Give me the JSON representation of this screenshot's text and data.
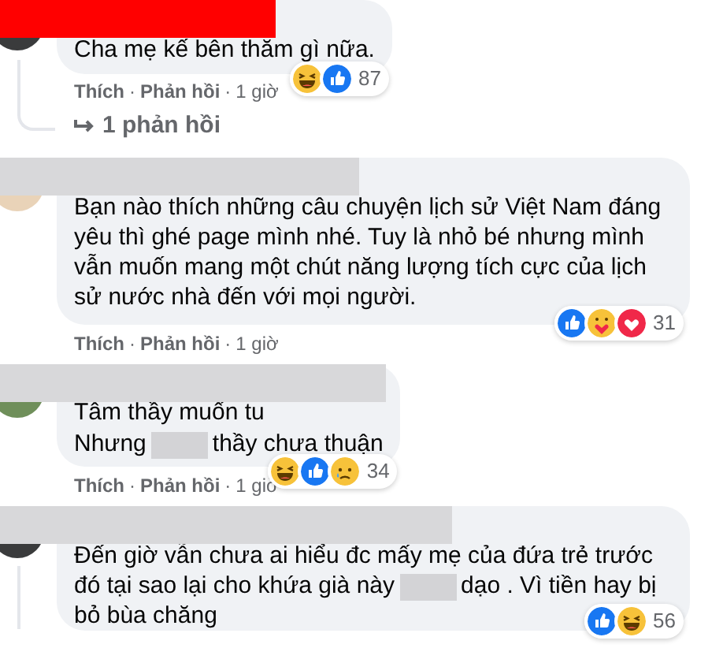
{
  "comments": [
    {
      "text": [
        {
          "kind": "text",
          "text": "Cha mẹ kế bên thăm gì nữa."
        }
      ],
      "reactions": [
        {
          "kind": "haha"
        },
        {
          "kind": "like"
        }
      ],
      "reaction_count": "87",
      "action_line": [
        {
          "kind": "link",
          "text": "Thích"
        },
        {
          "kind": "dot",
          "text": "·"
        },
        {
          "kind": "link",
          "text": "Phản hồi"
        },
        {
          "kind": "dot",
          "text": "·"
        },
        {
          "kind": "time",
          "text": "1 giờ"
        }
      ],
      "replies_link": "1 phản hồi"
    },
    {
      "text": [
        {
          "kind": "text",
          "text": "Bạn nào thích những câu chuyện lịch sử Việt Nam đáng yêu thì ghé page mình nhé. Tuy là nhỏ bé nhưng mình vẫn muốn mang một chút năng lượng tích cực của lịch sử nước nhà đến với mọi người."
        }
      ],
      "reactions": [
        {
          "kind": "like"
        },
        {
          "kind": "care"
        },
        {
          "kind": "love"
        }
      ],
      "reaction_count": "31",
      "action_line": [
        {
          "kind": "link",
          "text": "Thích"
        },
        {
          "kind": "dot",
          "text": "·"
        },
        {
          "kind": "link",
          "text": "Phản hồi"
        },
        {
          "kind": "dot",
          "text": "·"
        },
        {
          "kind": "time",
          "text": "1 giờ"
        }
      ]
    },
    {
      "text": [
        {
          "kind": "text",
          "text": "Tâm thầy muốn tu"
        },
        {
          "kind": "break"
        },
        {
          "kind": "text",
          "text": "Nhưng"
        },
        {
          "kind": "redacted"
        },
        {
          "kind": "text",
          "text": "thầy chưa thuận"
        }
      ],
      "reactions": [
        {
          "kind": "haha"
        },
        {
          "kind": "like"
        },
        {
          "kind": "sad"
        }
      ],
      "reaction_count": "34",
      "action_line": [
        {
          "kind": "link",
          "text": "Thích"
        },
        {
          "kind": "dot",
          "text": "·"
        },
        {
          "kind": "link",
          "text": "Phản hồi"
        },
        {
          "kind": "dot",
          "text": "·"
        },
        {
          "kind": "time",
          "text": "1 giờ"
        }
      ]
    },
    {
      "text": [
        {
          "kind": "text",
          "text": "Đến giờ vẫn chưa ai hiểu đc mấy mẹ của đứa trẻ trước đó tại sao lại cho khứa già này"
        },
        {
          "kind": "redacted"
        },
        {
          "kind": "text",
          "text": "dạo . Vì tiền hay bị bỏ bùa chăng"
        }
      ],
      "reactions": [
        {
          "kind": "like"
        },
        {
          "kind": "haha"
        }
      ],
      "reaction_count": "56"
    }
  ]
}
